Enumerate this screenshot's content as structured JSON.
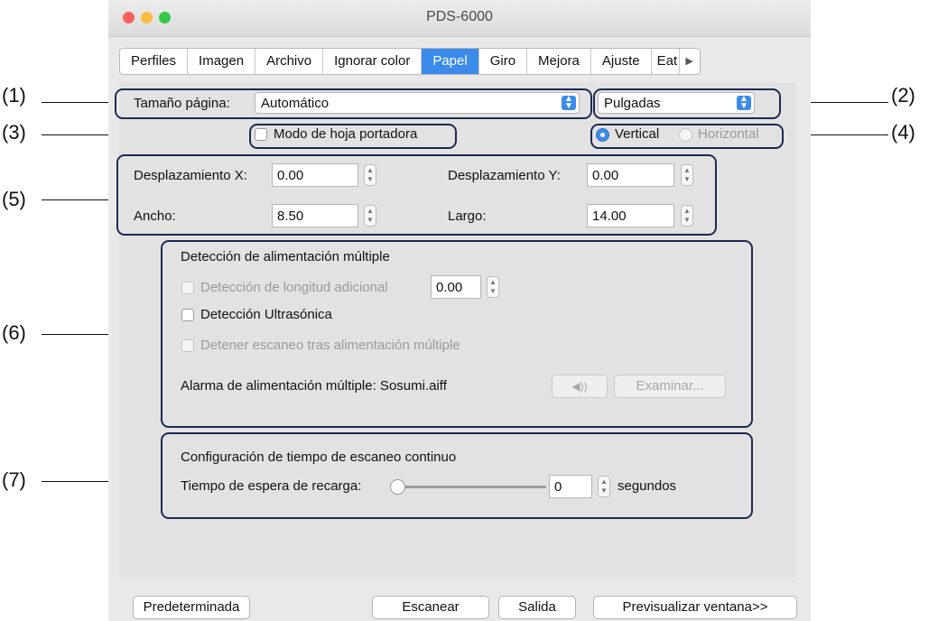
{
  "window": {
    "title": "PDS-6000"
  },
  "tabs": [
    {
      "label": "Perfiles",
      "active": false
    },
    {
      "label": "Imagen",
      "active": false
    },
    {
      "label": "Archivo",
      "active": false
    },
    {
      "label": "Ignorar color",
      "active": false
    },
    {
      "label": "Papel",
      "active": true
    },
    {
      "label": "Giro",
      "active": false
    },
    {
      "label": "Mejora",
      "active": false
    },
    {
      "label": "Ajuste",
      "active": false
    },
    {
      "label": "Eat",
      "active": false
    }
  ],
  "paper": {
    "size_label": "Tamaño página:",
    "size_value": "Automático",
    "units_value": "Pulgadas",
    "carrier_label": "Modo de hoja portadora",
    "carrier_checked": false,
    "orientation": {
      "vertical_label": "Vertical",
      "horizontal_label": "Horizontal",
      "selected": "Vertical"
    }
  },
  "dimensions": {
    "offset_x_label": "Desplazamiento X:",
    "offset_x_value": "0.00",
    "offset_y_label": "Desplazamiento Y:",
    "offset_y_value": "0.00",
    "width_label": "Ancho:",
    "width_value": "8.50",
    "length_label": "Largo:",
    "length_value": "14.00"
  },
  "multifeed": {
    "heading": "Detección de alimentación múltiple",
    "extra_length_label": "Detección de longitud adicional",
    "extra_length_value": "0.00",
    "ultrasonic_label": "Detección Ultrasónica",
    "stop_label": "Detener escaneo tras alimentación múltiple",
    "alarm_label": "Alarma de alimentación múltiple: Sosumi.aiff",
    "browse_label": "Examinar..."
  },
  "continuous": {
    "heading": "Configuración de tiempo de escaneo continuo",
    "reload_label": "Tiempo de espera de recarga:",
    "reload_value": "0",
    "reload_fraction": 0,
    "unit_label": "segundos"
  },
  "footer": {
    "default_label": "Predeterminada",
    "scan_label": "Escanear",
    "exit_label": "Salida",
    "preview_label": "Previsualizar ventana>>"
  },
  "callouts": [
    "(1)",
    "(2)",
    "(3)",
    "(4)",
    "(5)",
    "(6)",
    "(7)"
  ],
  "colors": {
    "accent": "#3b8bea",
    "annotation_border": "#1b2a52",
    "close": "#fc605c",
    "minimize": "#fdbc40",
    "zoom": "#34c84a"
  }
}
